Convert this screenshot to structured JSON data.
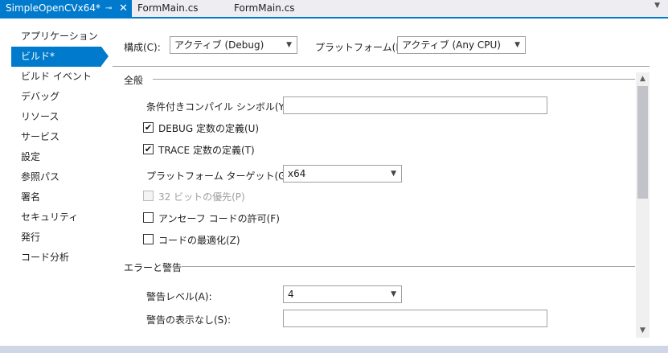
{
  "tabs": [
    {
      "label": "SimpleOpenCVx64*",
      "active": true
    },
    {
      "label": "FormMain.cs",
      "active": false
    },
    {
      "label": "FormMain.cs",
      "active": false
    }
  ],
  "tab_icons": {
    "pin": "pin-icon",
    "close": "close-icon",
    "dropdown": "chevron-down-icon"
  },
  "nav": {
    "items": [
      {
        "label": "アプリケーション"
      },
      {
        "label": "ビルド*"
      },
      {
        "label": "ビルド イベント"
      },
      {
        "label": "デバッグ"
      },
      {
        "label": "リソース"
      },
      {
        "label": "サービス"
      },
      {
        "label": "設定"
      },
      {
        "label": "参照パス"
      },
      {
        "label": "署名"
      },
      {
        "label": "セキュリティ"
      },
      {
        "label": "発行"
      },
      {
        "label": "コード分析"
      }
    ],
    "selected_index": 1
  },
  "header": {
    "config_label": "構成(C):",
    "config_value": "アクティブ (Debug)",
    "platform_label": "プラットフォーム(M):",
    "platform_value": "アクティブ (Any CPU)"
  },
  "general": {
    "title": "全般",
    "cond_symbols_label": "条件付きコンパイル シンボル(Y):",
    "cond_symbols_value": "",
    "debug_const": {
      "label": "DEBUG 定数の定義(U)",
      "checked": true
    },
    "trace_const": {
      "label": "TRACE 定数の定義(T)",
      "checked": true
    },
    "platform_target_label": "プラットフォーム ターゲット(G):",
    "platform_target_value": "x64",
    "prefer32": {
      "label": "32 ビットの優先(P)",
      "checked": false,
      "enabled": false
    },
    "unsafe": {
      "label": "アンセーフ コードの許可(F)",
      "checked": false
    },
    "optimize": {
      "label": "コードの最適化(Z)",
      "checked": false
    }
  },
  "errors": {
    "title": "エラーと警告",
    "warning_level_label": "警告レベル(A):",
    "warning_level_value": "4",
    "suppress_label": "警告の表示なし(S):",
    "suppress_value": ""
  },
  "check_mark": "✔",
  "colors": {
    "accent": "#007acc",
    "disabled": "#a0a0a0"
  }
}
